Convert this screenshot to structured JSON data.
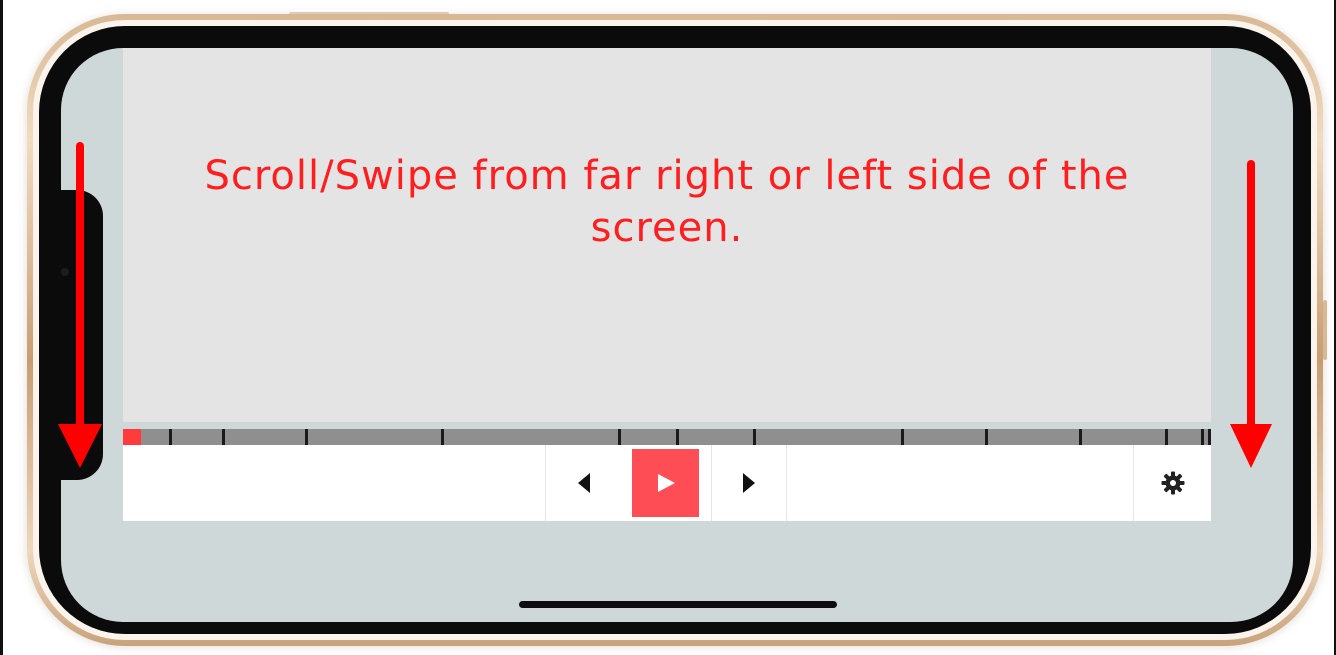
{
  "message": "Scroll/Swipe from far right or left side of the screen.",
  "progress": {
    "played_fraction": 0.017,
    "chapter_marker_fractions": [
      0.042,
      0.091,
      0.167,
      0.292,
      0.455,
      0.508,
      0.579,
      0.715,
      0.792,
      0.879,
      0.958,
      0.991,
      0.998
    ]
  },
  "controls": {
    "previous": "previous-icon",
    "play": "play-icon",
    "next": "next-icon",
    "settings": "gear-icon"
  },
  "colors": {
    "message": "#ff1d1d",
    "arrow": "#ff0000",
    "play_button": "#ff4d55",
    "progress_played": "#ff3b3b",
    "progress_track": "#8f8f8f",
    "content_background": "#e4e4e4"
  }
}
